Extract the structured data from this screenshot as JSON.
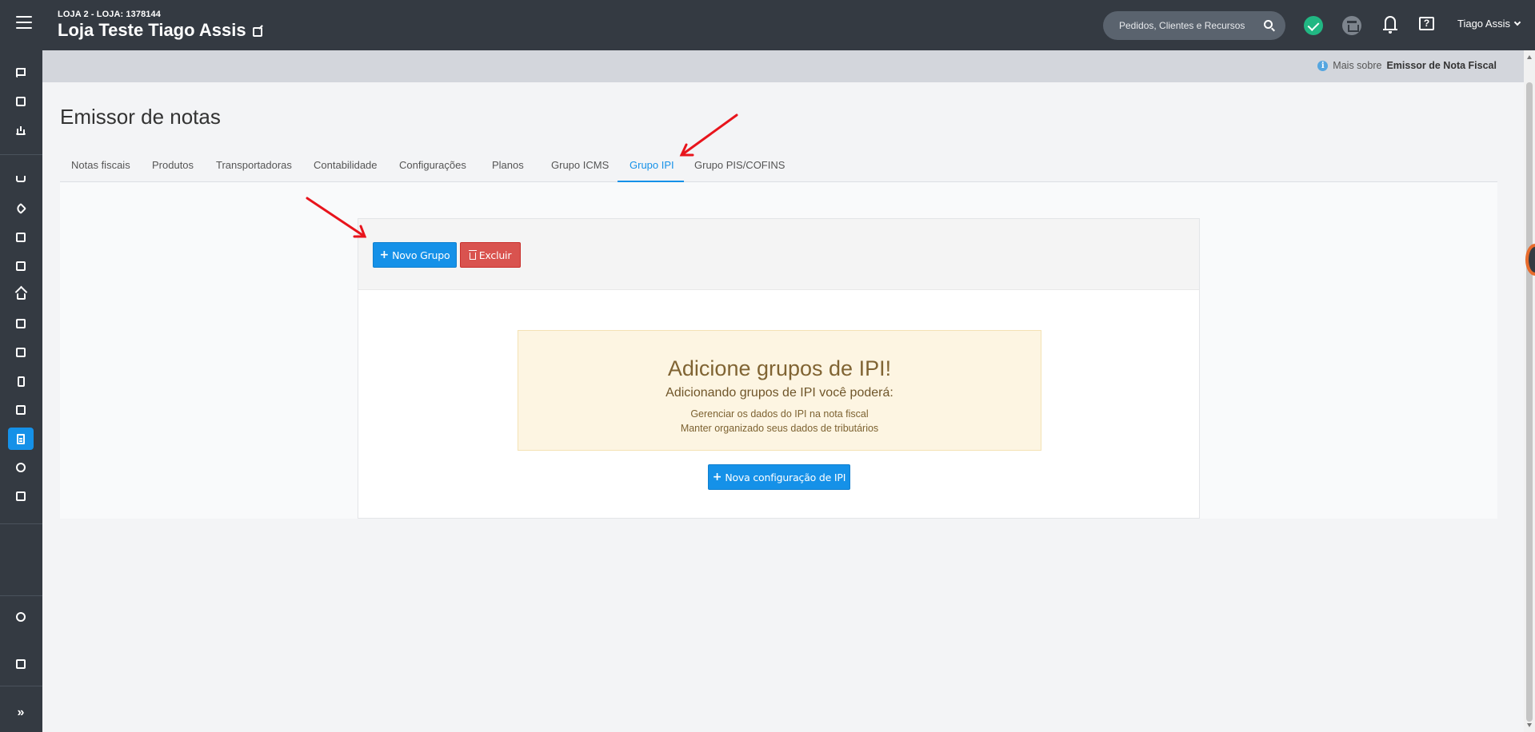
{
  "header": {
    "store_sub": "LOJA 2 - LOJA: 1378144",
    "store_name": "Loja Teste Tiago Assis",
    "search_placeholder": "Pedidos, Clientes e Recursos",
    "user_name": "Tiago Assis"
  },
  "info_strip": {
    "prefix": "Mais sobre",
    "link": "Emissor de Nota Fiscal"
  },
  "page": {
    "title": "Emissor de notas"
  },
  "tabs": [
    {
      "label": "Notas fiscais"
    },
    {
      "label": "Produtos"
    },
    {
      "label": "Transportadoras"
    },
    {
      "label": "Contabilidade"
    },
    {
      "label": "Configurações"
    },
    {
      "label": "Planos"
    },
    {
      "label": "Grupo ICMS"
    },
    {
      "label": "Grupo IPI"
    },
    {
      "label": "Grupo PIS/COFINS"
    }
  ],
  "active_tab": "Grupo IPI",
  "toolbar": {
    "new_group": "Novo Grupo",
    "delete": "Excluir"
  },
  "empty_state": {
    "title": "Adicione grupos de IPI!",
    "subtitle": "Adicionando grupos de IPI você poderá:",
    "bullets": [
      "Gerenciar os dados do IPI na nota fiscal",
      "Manter organizado seus dados de tributários"
    ],
    "cta": "Nova configuração de IPI"
  },
  "colors": {
    "topbar": "#343a42",
    "accent": "#1591e8",
    "danger": "#d9534f",
    "success": "#21b783",
    "annotation_arrow": "#e8141c"
  },
  "sidebar_icons": [
    "flag-icon",
    "calculator-icon",
    "chart-icon",
    "cart-icon",
    "tag-icon",
    "tv-icon",
    "monitor-icon",
    "home-icon",
    "desktop-icon",
    "layout-icon",
    "phone-icon",
    "mail-icon",
    "document-icon",
    "box-icon",
    "bag-icon",
    "gear-icon",
    "feedback-icon",
    "expand-icon"
  ]
}
